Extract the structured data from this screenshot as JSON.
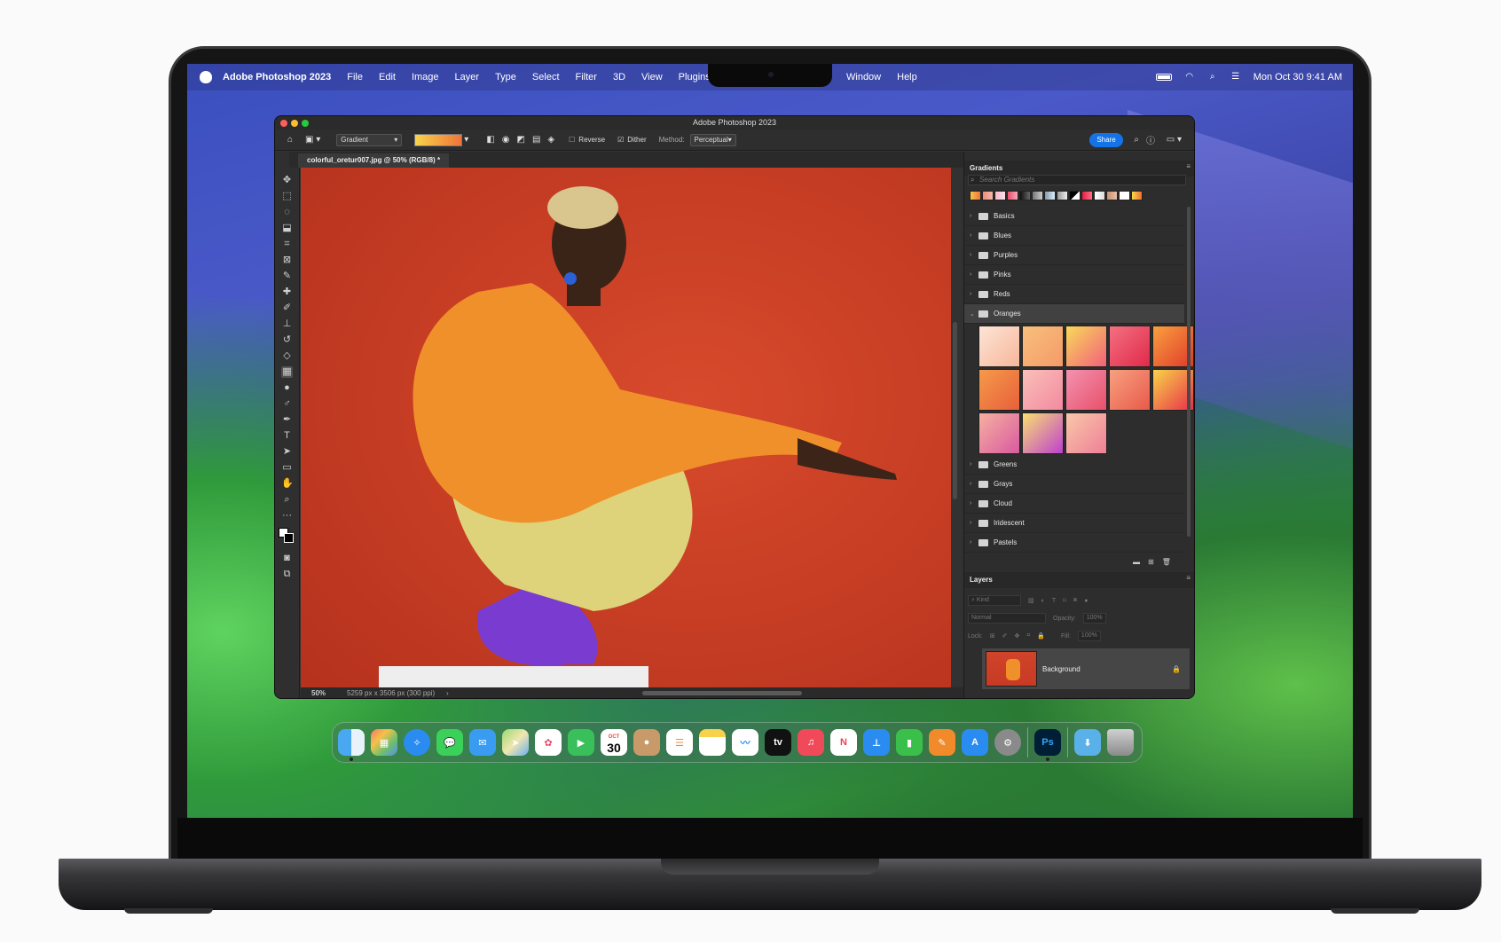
{
  "menubar": {
    "app_name": "Adobe Photoshop 2023",
    "left_items": [
      "File",
      "Edit",
      "Image",
      "Layer",
      "Type",
      "Select",
      "Filter",
      "3D",
      "View",
      "Plugins"
    ],
    "right_items": [
      "Window",
      "Help"
    ],
    "clock": "Mon Oct 30  9:41 AM"
  },
  "window": {
    "title": "Adobe Photoshop 2023"
  },
  "options": {
    "tool_preset": "Gradient",
    "reverse_label": "Reverse",
    "reverse_checked": false,
    "dither_label": "Dither",
    "dither_checked": true,
    "method_label": "Method:",
    "method_value": "Perceptual",
    "share_label": "Share"
  },
  "document": {
    "tab_title": "colorful_oretur007.jpg @ 50% (RGB/8) *",
    "zoom": "50%",
    "dimensions": "5259 px x 3506 px (300 ppi)"
  },
  "gradients_panel": {
    "title": "Gradients",
    "search_placeholder": "Search Gradients",
    "folders": [
      {
        "name": "Basics",
        "expanded": false
      },
      {
        "name": "Blues",
        "expanded": false
      },
      {
        "name": "Purples",
        "expanded": false
      },
      {
        "name": "Pinks",
        "expanded": false
      },
      {
        "name": "Reds",
        "expanded": false
      },
      {
        "name": "Oranges",
        "expanded": true
      },
      {
        "name": "Greens",
        "expanded": false
      },
      {
        "name": "Grays",
        "expanded": false
      },
      {
        "name": "Cloud",
        "expanded": false
      },
      {
        "name": "Iridescent",
        "expanded": false
      },
      {
        "name": "Pastels",
        "expanded": false
      }
    ]
  },
  "layers_panel": {
    "title": "Layers",
    "filter_label": "Kind",
    "blend_mode": "Normal",
    "opacity_label": "Opacity:",
    "opacity_value": "100%",
    "lock_label": "Lock:",
    "fill_label": "Fill:",
    "fill_value": "100%",
    "layers": [
      {
        "name": "Background",
        "visible": true,
        "locked": true
      }
    ]
  },
  "dock": {
    "calendar_month": "OCT",
    "calendar_day": "30",
    "tv_label": "tv",
    "photoshop_label": "Ps"
  },
  "colors": {
    "canvas_background": "#d0442a",
    "share_button": "#1473e6",
    "accent_orange": "#f0902a"
  }
}
